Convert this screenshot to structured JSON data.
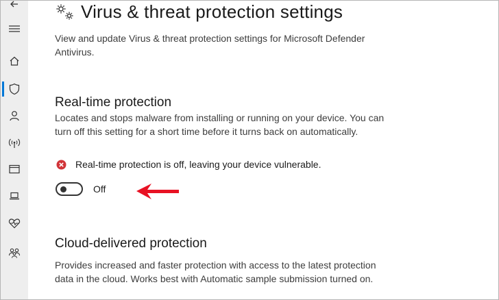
{
  "page": {
    "title": "Virus & threat protection settings",
    "title_icon": "gears-icon",
    "description": "View and update Virus & threat protection settings for Microsoft Defender Antivirus."
  },
  "sidebar": {
    "items": [
      {
        "icon": "back-arrow-icon"
      },
      {
        "icon": "hamburger-menu-icon"
      },
      {
        "icon": "home-icon"
      },
      {
        "icon": "shield-icon",
        "active": true
      },
      {
        "icon": "person-icon"
      },
      {
        "icon": "wifi-signal-icon"
      },
      {
        "icon": "app-browser-icon"
      },
      {
        "icon": "laptop-icon"
      },
      {
        "icon": "heart-health-icon"
      },
      {
        "icon": "family-icon"
      }
    ]
  },
  "realtime": {
    "heading": "Real-time protection",
    "description": "Locates and stops malware from installing or running on your device. You can turn off this setting for a short time before it turns back on automatically.",
    "alert_text": "Real-time protection is off, leaving your device vulnerable.",
    "toggle_state": "Off",
    "toggle_on": false
  },
  "cloud": {
    "heading": "Cloud-delivered protection",
    "description": "Provides increased and faster protection with access to the latest protection data in the cloud. Works best with Automatic sample submission turned on."
  },
  "colors": {
    "accent": "#0078d7",
    "error": "#d13438",
    "annotation_arrow": "#e81123"
  }
}
